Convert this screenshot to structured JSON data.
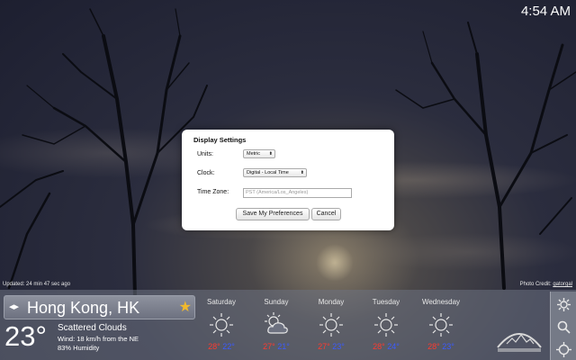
{
  "clock": "4:54 AM",
  "updated": "Updated: 24 min 47 sec ago",
  "photo_credit_prefix": "Photo Credit: ",
  "photo_credit_user": "gatorgal",
  "dialog": {
    "title": "Display Settings",
    "units_label": "Units:",
    "units_value": "Metric",
    "clock_label": "Clock:",
    "clock_value": "Digital - Local Time",
    "tz_label": "Time Zone:",
    "tz_placeholder": "PST (America/Los_Angeles)",
    "save_label": "Save My Preferences",
    "cancel_label": "Cancel"
  },
  "current": {
    "city": "Hong Kong, HK",
    "temp": "23°",
    "condition": "Scattered Clouds",
    "wind": "Wind: 18 km/h from the NE",
    "humidity": "83% Humidity"
  },
  "forecast": [
    {
      "day": "Saturday",
      "icon": "sun-icon",
      "high": "28°",
      "low": "22°"
    },
    {
      "day": "Sunday",
      "icon": "partly-cloudy-icon",
      "high": "27°",
      "low": "21°"
    },
    {
      "day": "Monday",
      "icon": "sun-icon",
      "high": "27°",
      "low": "23°"
    },
    {
      "day": "Tuesday",
      "icon": "sun-icon",
      "high": "28°",
      "low": "24°"
    },
    {
      "day": "Wednesday",
      "icon": "sun-icon",
      "high": "28°",
      "low": "23°"
    }
  ],
  "colors": {
    "high": "#ff3a2e",
    "low": "#3b5bff",
    "star": "#f0b92c"
  }
}
